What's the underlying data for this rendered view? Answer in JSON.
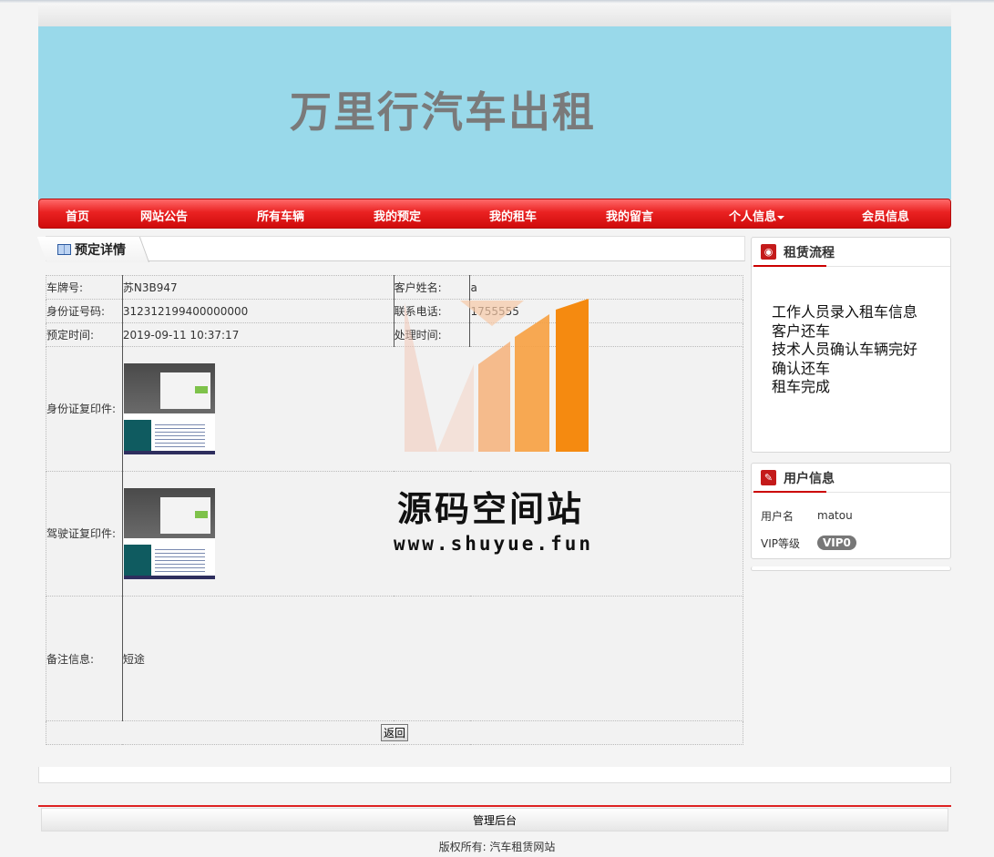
{
  "site": {
    "title": "万里行汽车出租"
  },
  "nav": {
    "items": [
      {
        "label": "首页"
      },
      {
        "label": "网站公告"
      },
      {
        "label": "所有车辆"
      },
      {
        "label": "我的预定"
      },
      {
        "label": "我的租车"
      },
      {
        "label": "我的留言"
      },
      {
        "label": "个人信息"
      },
      {
        "label": "会员信息"
      }
    ]
  },
  "main": {
    "tab_title": "预定详情",
    "fields": {
      "plate_label": "车牌号:",
      "plate_value": "苏N3B947",
      "customer_label": "客户姓名:",
      "customer_value": "a",
      "id_label": "身份证号码:",
      "id_value": "312312199400000000",
      "phone_label": "联系电话:",
      "phone_value": "1755555",
      "time_label": "预定时间:",
      "time_value": "2019-09-11 10:37:17",
      "handle_label": "处理时间:",
      "handle_value": "",
      "id_copy_label": "身份证复印件:",
      "license_copy_label": "驾驶证复印件:",
      "note_label": "备注信息:",
      "note_value": "短途"
    },
    "back_button": "返回"
  },
  "watermark": {
    "title": "源码空间站",
    "url": "www.shuyue.fun"
  },
  "sidebar": {
    "flow": {
      "title": "租赁流程",
      "steps": [
        "工作人员录入租车信息",
        "客户还车",
        "技术人员确认车辆完好",
        "确认还车",
        "租车完成"
      ]
    },
    "user": {
      "title": "用户信息",
      "name_label": "用户名",
      "name_value": "matou",
      "vip_label": "VIP等级",
      "vip_value": "VIP0"
    }
  },
  "footer": {
    "admin_link": "管理后台",
    "copyright": "版权所有: 汽车租赁网站"
  },
  "colors": {
    "banner": "#99d9ea",
    "nav_red": "#e02020",
    "accent": "#cc0000"
  }
}
